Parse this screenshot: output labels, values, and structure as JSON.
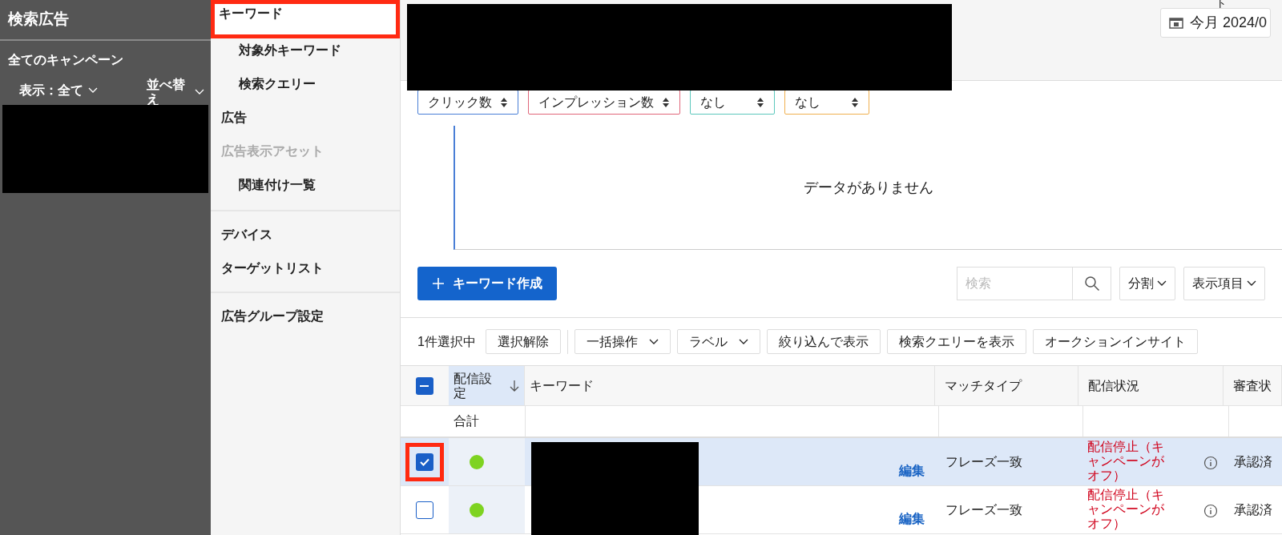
{
  "sidebar": {
    "title": "検索広告",
    "campaigns_label": "全てのキャンペーン",
    "filter": "表示：全て",
    "sort": "並べ替え"
  },
  "nav": {
    "groups": [
      [
        {
          "label": "キーワード",
          "highlighted": true,
          "disabled": false,
          "children": [
            {
              "label": "対象外キーワード"
            },
            {
              "label": "検索クエリー"
            }
          ]
        },
        {
          "label": "広告",
          "highlighted": false,
          "disabled": false
        },
        {
          "label": "広告表示アセット",
          "highlighted": false,
          "disabled": true,
          "children": [
            {
              "label": "関連付け一覧"
            }
          ]
        }
      ],
      [
        {
          "label": "デバイス",
          "highlighted": false,
          "disabled": false
        },
        {
          "label": "ターゲットリスト",
          "highlighted": false,
          "disabled": false
        }
      ],
      [
        {
          "label": "広告グループ設定",
          "highlighted": false,
          "disabled": false
        }
      ]
    ]
  },
  "header": {
    "cursor_fragment": "ト",
    "date_button": "今月 2024/0"
  },
  "chart": {
    "metric_selectors": [
      {
        "label": "クリック数",
        "color": "#4a7fd6"
      },
      {
        "label": "インプレッション数",
        "color": "#e0667a"
      },
      {
        "label": "なし",
        "color": "#5cc8bd"
      },
      {
        "label": "なし",
        "color": "#f0b050"
      }
    ],
    "empty_message": "データがありません"
  },
  "toolbar": {
    "create_button": "キーワード作成",
    "search": {
      "placeholder": "検索"
    },
    "split": "分割",
    "columns": "表示項目"
  },
  "selection_bar": {
    "count_label": "1件選択中",
    "buttons": [
      {
        "label": "選択解除",
        "kind": "plain"
      },
      {
        "label": "一括操作",
        "kind": "dropdown"
      },
      {
        "label": "ラベル",
        "kind": "dropdown"
      },
      {
        "label": "絞り込んで表示",
        "kind": "plain"
      },
      {
        "label": "検索クエリーを表示",
        "kind": "plain"
      },
      {
        "label": "オークションインサイト",
        "kind": "plain"
      }
    ]
  },
  "table": {
    "header_checkbox_partial": true,
    "columns": [
      {
        "label": "配信設定",
        "sorted": true
      },
      {
        "label": "キーワード",
        "sorted": false
      },
      {
        "label": "マッチタイプ",
        "sorted": false
      },
      {
        "label": "配信状況",
        "sorted": false
      },
      {
        "label": "審査状",
        "sorted": false
      }
    ],
    "total_label": "合計",
    "rows": [
      {
        "checked": true,
        "highlighted": true,
        "edit_label": "編集",
        "match_type": "フレーズ一致",
        "delivery_status": "配信停止（キャンペーンがオフ）",
        "review_status": "承認済"
      },
      {
        "checked": false,
        "highlighted": false,
        "edit_label": "編集",
        "match_type": "フレーズ一致",
        "delivery_status": "配信停止（キャンペーンがオフ）",
        "review_status": "承認済"
      }
    ]
  }
}
